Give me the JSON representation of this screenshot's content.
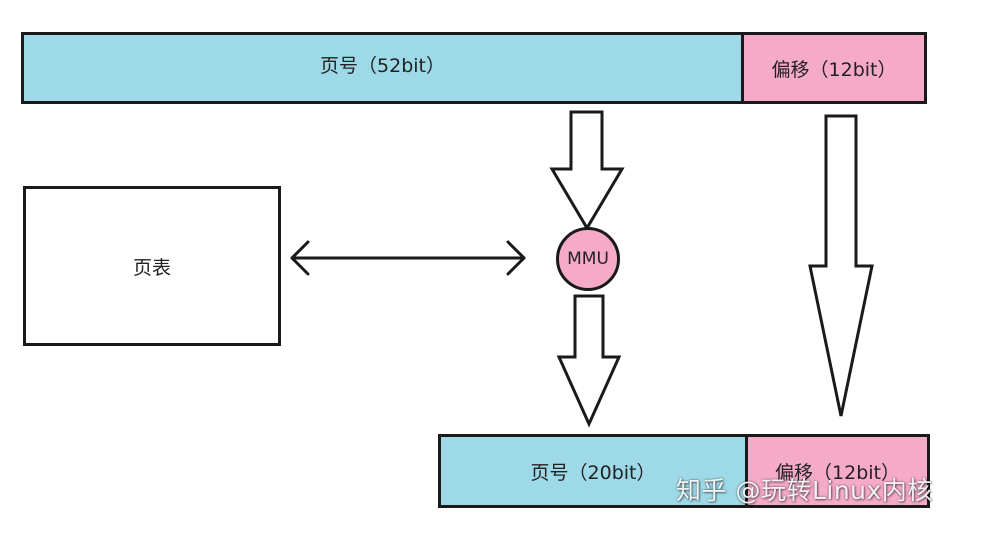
{
  "top_address": {
    "page_number_label": "页号（52bit）",
    "offset_label": "偏移（12bit）"
  },
  "page_table_label": "页表",
  "mmu_label": "MMU",
  "bottom_address": {
    "page_number_label": "页号（20bit）",
    "offset_label": "偏移（12bit）"
  },
  "watermark": "知乎 @玩转Linux内核",
  "colors": {
    "page_number_fill": "#9ed9e8",
    "offset_fill": "#f5aac8",
    "mmu_fill": "#f5aac8",
    "stroke": "#1a1a1a"
  }
}
